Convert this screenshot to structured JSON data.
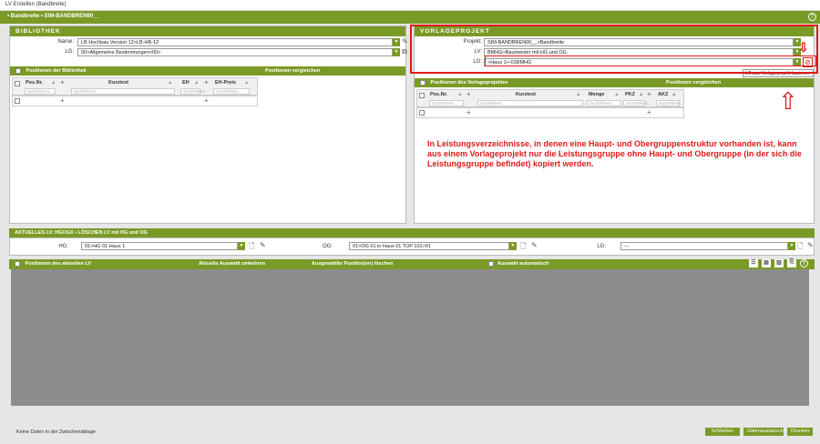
{
  "window": {
    "title": "LV Erstellen (Bandbreite)"
  },
  "topbar": {
    "breadcrumb": "• Bandbreite • SIM-BANDBREN00__"
  },
  "bibliothek": {
    "header": "BIBLIOTHEK",
    "name_label": "Name:",
    "name_value": "LB Hochbau Version 12>LB-HB-12",
    "lg_label": "LG:",
    "lg_value": "00>Allgemeine Bestimmungen>00>",
    "positions_label": "Positionen der Bibliothek",
    "compare_label": "Positionen vergleichen",
    "columns": [
      "Pos.Nr.",
      "Kurztext",
      "EH",
      "EH-Preis"
    ],
    "filter_placeholder": "Such/Filtern..."
  },
  "vorlage": {
    "header": "VORLAGEPROJEKT",
    "projekt_label": "Projekt:",
    "projekt_value": "SIM-BANDBREN00__>Bandbreite",
    "lv_label": "LV:",
    "lv_value": "BMHG>Baumeister mit HG und OG",
    "lg_label": "LG:",
    "lg_value": "<Haus 1>-01BMHG",
    "tooltip": "LG aus Vorlageprojekt kopieren",
    "positions_label": "Positionen des Vorlageprojektes",
    "compare_label": "Positionen vergleichen",
    "columns": [
      "Pos.Nr.",
      "Kurztext",
      "Menge",
      "PKZ",
      "AKZ"
    ],
    "filter_placeholder": "Such/Filtern..."
  },
  "annotation": "In Leistungsverzeichnisse, in denen eine Haupt- und Obergruppenstruktur vorhanden ist, kann aus einem Vorlageprojekt nur die Leistungsgruppe ohne Haupt- und Obergruppe (in der sich die Leistungsgruppe befindet) kopiert werden.",
  "aktuell": {
    "header": "AKTUELLES LV: HGOGX • LÖSCHEN LV mit HG und OG",
    "hg_label": "HG:",
    "hg_value": "01>HG 01 Haus 1",
    "og_label": "OG:",
    "og_value": "01>OG 01 in Haus 01 TOP 101>01",
    "lg_label": "LG:",
    "lg_value": "---",
    "positions_label": "Positionen des aktuellen LV",
    "invert_label": "Aktuelle Auswahl umkehren",
    "delete_label": "Ausgewählte Position(en) löschen",
    "auto_label": "Auswahl automatisch"
  },
  "footer": {
    "status": "Keine Daten in der Zwischenablage",
    "buttons": [
      "Schließen",
      "Datenaustausch",
      "Drucken"
    ]
  },
  "colors": {
    "accent": "#7a9a26",
    "annotation": "#e01919"
  }
}
